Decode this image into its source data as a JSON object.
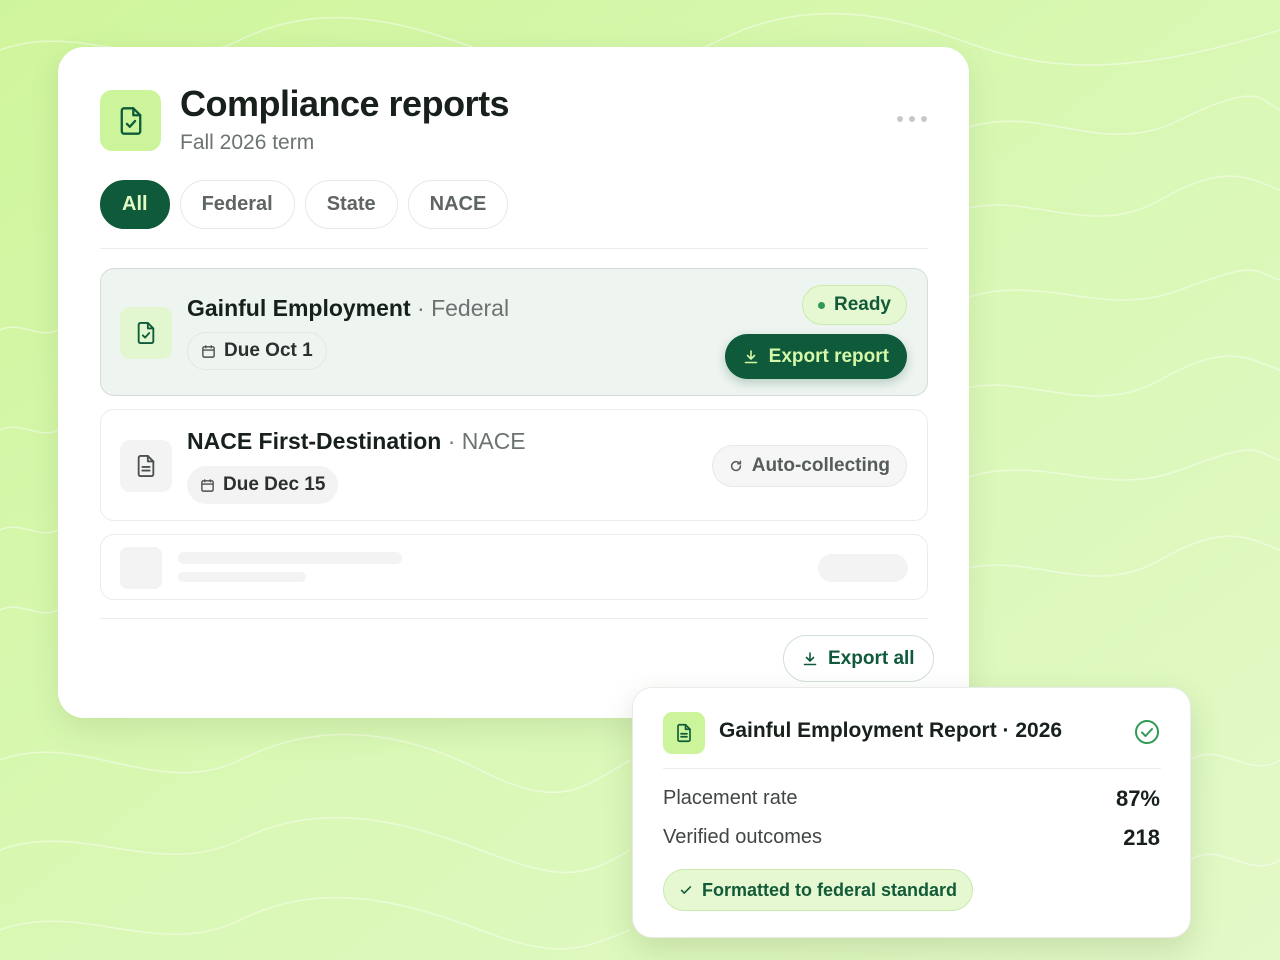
{
  "header": {
    "title": "Compliance reports",
    "subtitle": "Fall 2026 term",
    "app_icon": "document-check-icon",
    "more_icon": "more-dots-icon"
  },
  "filters": {
    "chips": [
      {
        "label": "All",
        "active": true
      },
      {
        "label": "Federal",
        "active": false
      },
      {
        "label": "State",
        "active": false
      },
      {
        "label": "NACE",
        "active": false
      }
    ]
  },
  "reports": [
    {
      "name": "Gainful Employment",
      "category": "· Federal",
      "due": "Due Oct 1",
      "status": "Ready",
      "action": "Export report",
      "icon": "document-check-icon",
      "selected": true
    },
    {
      "name": "NACE First-Destination",
      "category": "· NACE",
      "due": "Due Dec 15",
      "status": "Auto-collecting",
      "icon": "document-text-icon",
      "selected": false
    }
  ],
  "footer": {
    "export_all_label": "Export all"
  },
  "popup": {
    "title": "Gainful Employment Report · 2026",
    "stats": [
      {
        "label": "Placement rate",
        "value": "87%"
      },
      {
        "label": "Verified outcomes",
        "value": "218"
      }
    ],
    "badge": "Formatted to federal standard"
  },
  "colors": {
    "background": "#d9f7b0",
    "accent_dark": "#0f5a3a",
    "accent_light": "#ccf59b",
    "ready_bg": "#e6f8d2"
  }
}
